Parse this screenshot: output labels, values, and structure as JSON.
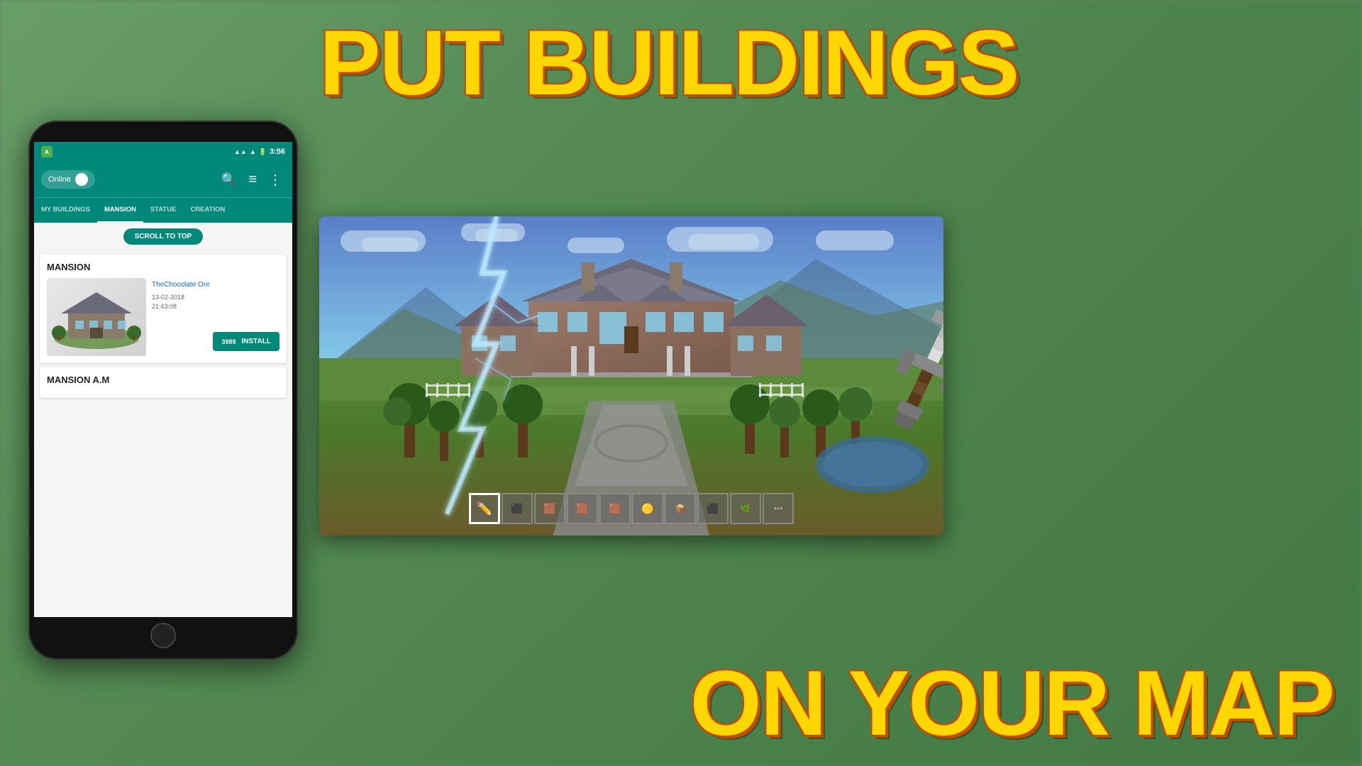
{
  "background": {
    "color_left": "#6a9a6a",
    "color_right": "#4a7a4a"
  },
  "headline": {
    "line1": "PUT BUILDINGS",
    "line2": "ON YOUR MAP",
    "color": "#FFD700",
    "shadow_color": "#c44a00"
  },
  "phone": {
    "status_bar": {
      "app_indicator": "A",
      "signal_icon": "▲",
      "wifi_icon": "▲",
      "battery": "□",
      "time": "3:56"
    },
    "toolbar": {
      "online_label": "Online",
      "search_icon": "🔍",
      "filter_icon": "≡",
      "more_icon": "⋮"
    },
    "tabs": [
      {
        "label": "MY BUILDINGS",
        "active": false
      },
      {
        "label": "MANSION",
        "active": true
      },
      {
        "label": "STATUE",
        "active": false
      },
      {
        "label": "CREATION",
        "active": false
      }
    ],
    "scroll_to_top_btn": "SCROLL TO TOP",
    "cards": [
      {
        "title": "MANSION",
        "author": "TheChocolate Ore",
        "date": "13-02-2018\n21:43:08",
        "install_count": "3989",
        "install_label": "INSTALL"
      },
      {
        "title": "MANSION A.M",
        "author": "",
        "date": "",
        "install_count": "",
        "install_label": ""
      }
    ]
  },
  "minecraft_screenshot": {
    "hotbar_slots": [
      {
        "icon": "✏",
        "active": true
      },
      {
        "icon": "⬛",
        "active": false
      },
      {
        "icon": "🟫",
        "active": false
      },
      {
        "icon": "🟫",
        "active": false
      },
      {
        "icon": "🟫",
        "active": false
      },
      {
        "icon": "🟡",
        "active": false
      },
      {
        "icon": "📦",
        "active": false
      },
      {
        "icon": "⬛",
        "active": false
      },
      {
        "icon": "🌿",
        "active": false
      },
      {
        "icon": "…",
        "active": false
      }
    ]
  }
}
